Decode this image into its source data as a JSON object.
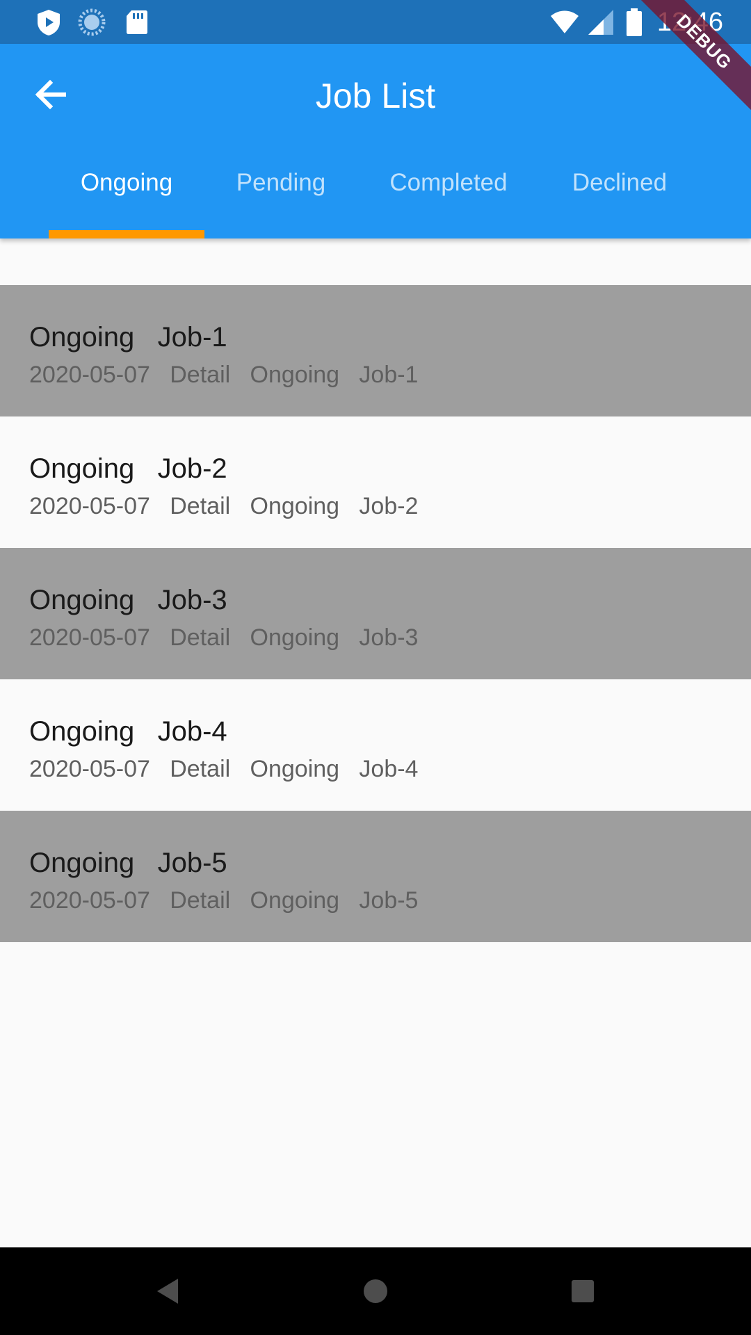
{
  "status_bar": {
    "time": "12:46",
    "icons": [
      "play-protect-icon",
      "sync-icon",
      "sd-card-icon",
      "wifi-icon",
      "signal-icon",
      "battery-icon"
    ],
    "background": "#1e71b8"
  },
  "app_bar": {
    "title": "Job List",
    "back_icon": "arrow-back-icon",
    "background": "#2196f3"
  },
  "tabs": [
    {
      "label": "Ongoing",
      "active": true
    },
    {
      "label": "Pending",
      "active": false
    },
    {
      "label": "Completed",
      "active": false
    },
    {
      "label": "Declined",
      "active": false
    }
  ],
  "indicator_color": "#ff9800",
  "jobs": [
    {
      "title": "Ongoing   Job-1",
      "subtitle": "2020-05-07   Detail   Ongoing   Job-1"
    },
    {
      "title": "Ongoing   Job-2",
      "subtitle": "2020-05-07   Detail   Ongoing   Job-2"
    },
    {
      "title": "Ongoing   Job-3",
      "subtitle": "2020-05-07   Detail   Ongoing   Job-3"
    },
    {
      "title": "Ongoing   Job-4",
      "subtitle": "2020-05-07   Detail   Ongoing   Job-4"
    },
    {
      "title": "Ongoing   Job-5",
      "subtitle": "2020-05-07   Detail   Ongoing   Job-5"
    }
  ],
  "debug_banner": "DEBUG",
  "nav_bar": {
    "icons": [
      "nav-back-icon",
      "nav-home-icon",
      "nav-recents-icon"
    ]
  }
}
